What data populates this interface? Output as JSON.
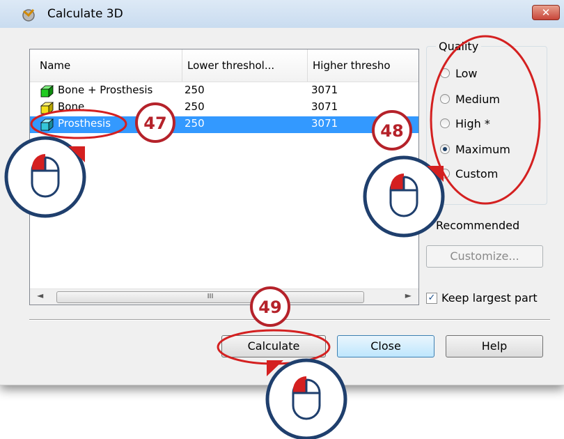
{
  "window": {
    "title": "Calculate 3D",
    "close_glyph": "✕"
  },
  "table": {
    "columns": [
      "Name",
      "Lower threshol...",
      "Higher thresho"
    ],
    "rows": [
      {
        "name": "Bone + Prosthesis",
        "lower": "250",
        "higher": "3071",
        "color": "#22cc22",
        "selected": false
      },
      {
        "name": "Bone",
        "lower": "250",
        "higher": "3071",
        "color": "#f2e01a",
        "selected": false
      },
      {
        "name": "Prosthesis",
        "lower": "250",
        "higher": "3071",
        "color": "#35c6d8",
        "selected": true
      }
    ],
    "scroll_left": "◄",
    "scroll_right": "►",
    "scroll_grip": "III"
  },
  "quality": {
    "title": "Quality",
    "options": [
      "Low",
      "Medium",
      "High *",
      "Maximum",
      "Custom"
    ],
    "selected": "Maximum",
    "recommended_text": "Recommended",
    "customize_label": "Customize..."
  },
  "keep_largest": {
    "label": "Keep largest part",
    "checked": true,
    "check_glyph": "✓"
  },
  "buttons": {
    "calculate": "Calculate",
    "close": "Close",
    "help": "Help"
  },
  "annotations": {
    "step47": "47",
    "step48": "48",
    "step49": "49",
    "accent": "#d42020"
  }
}
